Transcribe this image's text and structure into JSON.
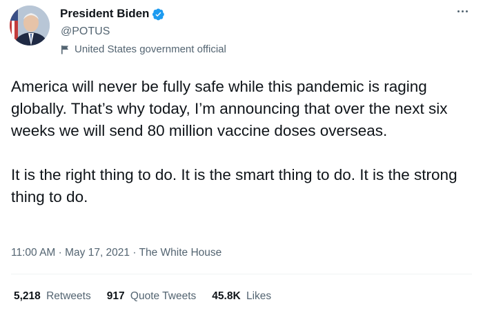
{
  "header": {
    "display_name": "President Biden",
    "handle": "@POTUS",
    "affiliation": "United States government official",
    "verified_icon": "verified-badge-icon",
    "affiliation_icon": "flag-icon",
    "more_icon": "more-options-icon"
  },
  "tweet": {
    "paragraphs": [
      "America will never be fully safe while this pandemic is raging globally. That’s why today, I’m announcing that over the next six weeks we will send 80 million vaccine doses overseas.",
      "It is the right thing to do. It is the smart thing to do. It is the strong thing to do."
    ],
    "timestamp": "11:00 AM · May 17, 2021 · The White House"
  },
  "stats": [
    {
      "count": "5,218",
      "label": "Retweets"
    },
    {
      "count": "917",
      "label": "Quote Tweets"
    },
    {
      "count": "45.8K",
      "label": "Likes"
    }
  ],
  "colors": {
    "verified": "#1d9bf0",
    "text_primary": "#0f1419",
    "text_secondary": "#536471",
    "divider": "#eff3f4"
  }
}
